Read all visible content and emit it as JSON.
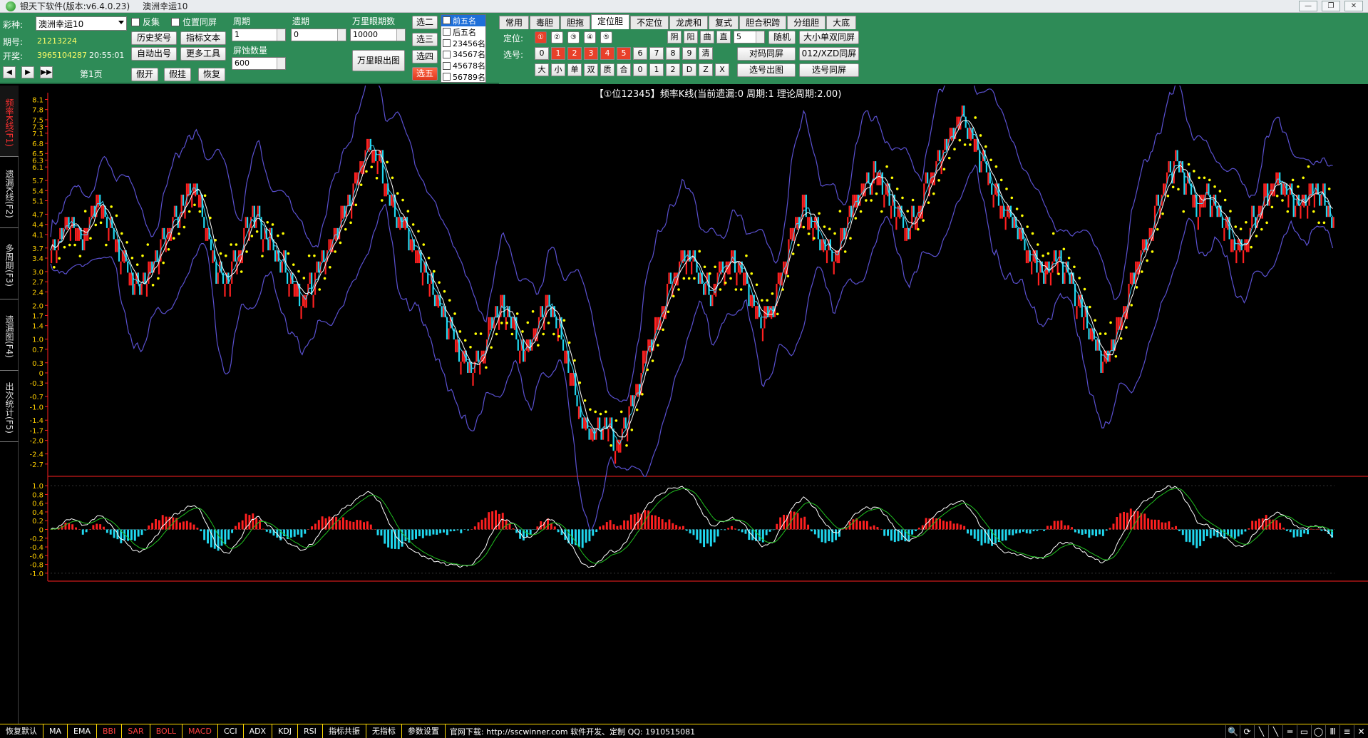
{
  "window": {
    "title": "银天下软件(版本:v6.4.0.23)",
    "subtitle": "澳洲幸运10",
    "buttons": [
      "—",
      "❐",
      "✕"
    ]
  },
  "toolbar": {
    "lottery_label": "彩种:",
    "lottery_value": "澳洲幸运10",
    "period_label": "期号:",
    "period_value": "21213224",
    "draw_label": "开奖:",
    "draw_value": "3965104287",
    "draw_time": "20:55:01",
    "page_label": "第1页",
    "nav": [
      "◀",
      "▶",
      "▶▶"
    ],
    "checks": [
      {
        "label": "反集",
        "checked": false
      },
      {
        "label": "位置同屏",
        "checked": false
      }
    ],
    "buttons": {
      "history": "历史奖号",
      "indicator_text": "指标文本",
      "auto_out": "自动出号",
      "more_tools": "更多工具",
      "fake_open": "假开",
      "fake_hang": "假挂",
      "restore": "恢复",
      "wan_li": "万里眼出图"
    },
    "cycle_label": "周期",
    "cycle_value": "1",
    "miss_label": "遗期",
    "miss_value": "0",
    "wanli_label": "万里眼期数",
    "wanli_value": "10000",
    "screen_label": "屏蚀数量",
    "screen_value": "600",
    "choose": [
      "选二",
      "选三",
      "选四",
      "选五"
    ],
    "choose_active": 3
  },
  "ranks": [
    {
      "label": "前五名",
      "checked": true
    },
    {
      "label": "后五名",
      "checked": false
    },
    {
      "label": "23456名",
      "checked": false
    },
    {
      "label": "34567名",
      "checked": false
    },
    {
      "label": "45678名",
      "checked": false
    },
    {
      "label": "56789名",
      "checked": false
    }
  ],
  "tabs": [
    "常用",
    "毒胆",
    "胆拖",
    "定位胆",
    "不定位",
    "龙虎和",
    "复式",
    "胆合积跨",
    "分组胆",
    "大底"
  ],
  "active_tab": 3,
  "dingwei": {
    "pos_label": "定位:",
    "pos": [
      "①",
      "②",
      "③",
      "④",
      "⑤"
    ],
    "pick_label": "选号:",
    "digits": [
      "0",
      "1",
      "2",
      "3",
      "4",
      "5",
      "6",
      "7",
      "8",
      "9",
      "清"
    ],
    "digits_red": [
      1,
      2,
      3,
      4,
      5
    ],
    "shape": [
      "大",
      "小",
      "单",
      "双",
      "质",
      "合",
      "0",
      "1",
      "2",
      "D",
      "Z",
      "X"
    ],
    "yin": "阴",
    "yang": "阳",
    "qu": "曲",
    "zhi": "直",
    "count": "5",
    "random": "随机",
    "big_small": "大小单双同屏",
    "pair": "对码同屏",
    "xzd": "012/XZD同屏",
    "out": "选号出图",
    "same": "选号同屏"
  },
  "vtabs": [
    {
      "label": "频率K线(F1)",
      "active": true
    },
    {
      "label": "遗漏K线(F2)",
      "active": false
    },
    {
      "label": "多周期(F3)",
      "active": false
    },
    {
      "label": "遗漏图(F4)",
      "active": false
    },
    {
      "label": "出次统计(F5)",
      "active": false
    }
  ],
  "chart_data": [
    {
      "type": "candlestick",
      "title": "【①位12345】频率K线(当前遗漏:0 周期:1 理论周期:2.00)",
      "ylim": [
        -3.0,
        8.3
      ],
      "yticks": [
        "8.1",
        "7.8",
        "7.5",
        "7.3",
        "7.1",
        "6.8",
        "6.5",
        "6.3",
        "6.1",
        "5.7",
        "5.4",
        "5.1",
        "4.7",
        "4.4",
        "4.1",
        "3.7",
        "3.4",
        "3.0",
        "2.7",
        "2.4",
        "2.0",
        "1.7",
        "1.4",
        "1.0",
        "0.7",
        "0.3",
        "0",
        "-0.3",
        "-0.7",
        "-1.0",
        "-1.4",
        "-1.7",
        "-2.0",
        "-2.4",
        "-2.7"
      ],
      "anchors": [
        [
          0,
          3.6
        ],
        [
          10,
          4.6
        ],
        [
          18,
          4.0
        ],
        [
          26,
          5.2
        ],
        [
          34,
          4.3
        ],
        [
          42,
          3.3
        ],
        [
          50,
          2.5
        ],
        [
          58,
          3.2
        ],
        [
          66,
          4.1
        ],
        [
          74,
          4.9
        ],
        [
          82,
          5.6
        ],
        [
          88,
          4.6
        ],
        [
          94,
          3.3
        ],
        [
          100,
          2.6
        ],
        [
          108,
          3.6
        ],
        [
          116,
          4.8
        ],
        [
          122,
          4.2
        ],
        [
          130,
          3.5
        ],
        [
          138,
          2.7
        ],
        [
          144,
          2.2
        ],
        [
          150,
          2.7
        ],
        [
          158,
          3.6
        ],
        [
          166,
          4.4
        ],
        [
          172,
          5.2
        ],
        [
          178,
          6.2
        ],
        [
          184,
          6.8
        ],
        [
          190,
          6.2
        ],
        [
          196,
          5.0
        ],
        [
          204,
          4.4
        ],
        [
          212,
          3.4
        ],
        [
          220,
          2.5
        ],
        [
          228,
          1.5
        ],
        [
          236,
          0.5
        ],
        [
          242,
          0.1
        ],
        [
          248,
          0.6
        ],
        [
          254,
          1.6
        ],
        [
          260,
          2.1
        ],
        [
          266,
          1.4
        ],
        [
          272,
          0.5
        ],
        [
          278,
          1.2
        ],
        [
          284,
          2.1
        ],
        [
          290,
          1.7
        ],
        [
          296,
          0.7
        ],
        [
          302,
          -0.6
        ],
        [
          308,
          -1.6
        ],
        [
          314,
          -1.8
        ],
        [
          320,
          -1.5
        ],
        [
          326,
          -2.1
        ],
        [
          332,
          -1.3
        ],
        [
          338,
          -0.3
        ],
        [
          344,
          0.8
        ],
        [
          350,
          1.6
        ],
        [
          356,
          2.6
        ],
        [
          362,
          3.3
        ],
        [
          368,
          3.5
        ],
        [
          374,
          2.8
        ],
        [
          380,
          2.3
        ],
        [
          386,
          3.1
        ],
        [
          392,
          3.5
        ],
        [
          398,
          3.0
        ],
        [
          404,
          2.2
        ],
        [
          410,
          1.5
        ],
        [
          416,
          2.0
        ],
        [
          422,
          3.3
        ],
        [
          428,
          4.4
        ],
        [
          434,
          5.0
        ],
        [
          440,
          4.3
        ],
        [
          446,
          3.7
        ],
        [
          452,
          3.4
        ],
        [
          458,
          4.4
        ],
        [
          464,
          5.3
        ],
        [
          470,
          5.6
        ],
        [
          476,
          6.0
        ],
        [
          482,
          5.3
        ],
        [
          488,
          4.7
        ],
        [
          494,
          4.2
        ],
        [
          500,
          5.0
        ],
        [
          506,
          5.8
        ],
        [
          512,
          6.4
        ],
        [
          518,
          7.0
        ],
        [
          524,
          7.7
        ],
        [
          530,
          7.1
        ],
        [
          536,
          6.3
        ],
        [
          542,
          5.6
        ],
        [
          548,
          4.9
        ],
        [
          554,
          4.5
        ],
        [
          560,
          3.9
        ],
        [
          566,
          3.3
        ],
        [
          572,
          2.9
        ],
        [
          578,
          3.5
        ],
        [
          584,
          3.1
        ],
        [
          590,
          2.4
        ],
        [
          596,
          1.6
        ],
        [
          602,
          0.9
        ],
        [
          606,
          0.3
        ],
        [
          612,
          0.9
        ],
        [
          618,
          2.0
        ],
        [
          624,
          3.0
        ],
        [
          630,
          3.8
        ],
        [
          636,
          4.7
        ],
        [
          642,
          5.6
        ],
        [
          648,
          6.3
        ],
        [
          654,
          5.7
        ],
        [
          660,
          5.0
        ],
        [
          666,
          5.3
        ],
        [
          672,
          4.8
        ],
        [
          678,
          4.3
        ],
        [
          684,
          3.6
        ],
        [
          690,
          4.2
        ],
        [
          696,
          4.9
        ],
        [
          702,
          5.4
        ],
        [
          708,
          5.8
        ],
        [
          714,
          5.3
        ],
        [
          720,
          4.9
        ],
        [
          726,
          5.5
        ],
        [
          732,
          5.2
        ],
        [
          738,
          4.6
        ]
      ],
      "up_color": "#ff2020",
      "down_color": "#20d8f0"
    },
    {
      "type": "macd",
      "label": "MACD",
      "ylim": [
        -1.1,
        1.1
      ],
      "yticks": [
        "1.0",
        "0.8",
        "0.6",
        "0.4",
        "0.2",
        "0",
        "-0.2",
        "-0.4",
        "-0.6",
        "-0.8",
        "-1.0"
      ]
    }
  ],
  "bottom": {
    "buttons": [
      {
        "label": "恢复默认",
        "red": false
      },
      {
        "label": "MA",
        "red": false
      },
      {
        "label": "EMA",
        "red": false
      },
      {
        "label": "BBI",
        "red": true
      },
      {
        "label": "SAR",
        "red": true
      },
      {
        "label": "BOLL",
        "red": true
      },
      {
        "label": "MACD",
        "red": true
      },
      {
        "label": "CCI",
        "red": false
      },
      {
        "label": "ADX",
        "red": false
      },
      {
        "label": "KDJ",
        "red": false
      },
      {
        "label": "RSI",
        "red": false
      },
      {
        "label": "指标共振",
        "red": false
      },
      {
        "label": "无指标",
        "red": false
      },
      {
        "label": "参数设置",
        "red": false
      }
    ],
    "info": "官网下载: http://sscwinner.com  软件开发、定制  QQ: 1910515081",
    "icons": [
      "search-icon",
      "refresh-icon",
      "line-tool-icon",
      "ray-tool-icon",
      "channel-tool-icon",
      "rect-tool-icon",
      "ellipse-tool-icon",
      "text-tool-icon",
      "fib-tool-icon",
      "delete-icon"
    ],
    "icon_glyphs": [
      "🔍",
      "⟳",
      "╲",
      "╲",
      "═",
      "▭",
      "◯",
      "Ⅲ",
      "≡",
      "✕"
    ]
  }
}
